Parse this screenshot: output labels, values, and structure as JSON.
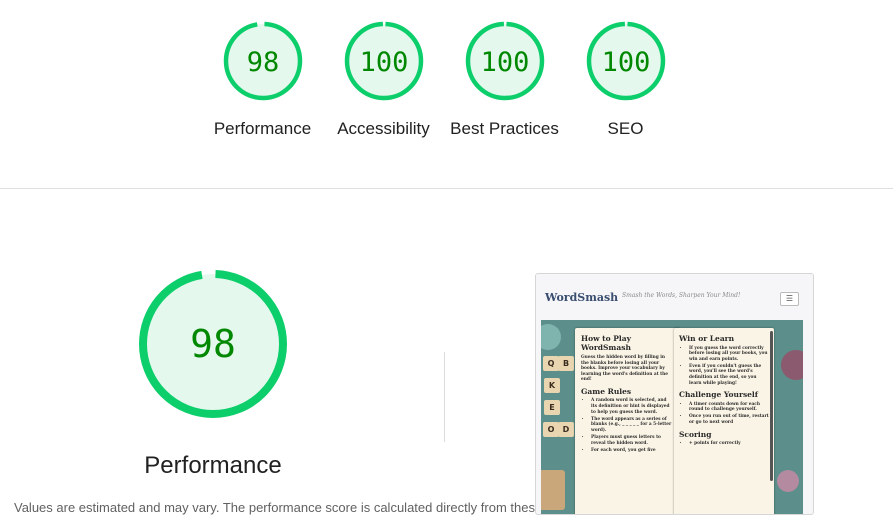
{
  "summary": {
    "categories": [
      {
        "label": "Performance",
        "score": "98",
        "value": 98
      },
      {
        "label": "Accessibility",
        "score": "100",
        "value": 100
      },
      {
        "label": "Best Practices",
        "score": "100",
        "value": 100
      },
      {
        "label": "SEO",
        "score": "100",
        "value": 100
      }
    ]
  },
  "performance": {
    "score": "98",
    "value": 98,
    "label": "Performance",
    "cutoff_text": "Values are estimated and may vary. The performance score is calculated directly from these metrics. See calculator."
  },
  "colors": {
    "pass": "#0cce6b",
    "pass_fill": "#e5f8ee",
    "pass_text": "#008800",
    "divider": "#e0e0e0"
  },
  "screenshot": {
    "logo": "WordSmash",
    "tagline": "Smash the Words, Sharpen Your Mind!",
    "menu_icon": "hamburger-icon",
    "tiles": [
      "Q",
      "B",
      "K",
      "E",
      "O",
      "D"
    ],
    "card_left": {
      "title": "How to Play WordSmash",
      "intro": "Guess the hidden word by filling in the blanks before losing all your books. Improve your vocabulary by learning the word's definition at the end!",
      "rules_title": "Game Rules",
      "rules": [
        "A random word is selected, and its definition or hint is displayed to help you guess the word.",
        "The word appears as a series of blanks (e.g., _ _ _ _ _ for a 5-letter word).",
        "Players must guess letters to reveal the hidden word.",
        "For each word, you get five"
      ]
    },
    "card_right": {
      "title": "Win or Learn",
      "items": [
        "If you guess the word correctly before losing all your books, you win and earn points.",
        "Even if you couldn't guess the word, you'll see the word's definition at the end, so you learn while playing!"
      ],
      "challenge_title": "Challenge Yourself",
      "challenge_items": [
        "A timer counts down for each round to challenge yourself.",
        "Once you run out of time, restart or go to next word"
      ],
      "scoring_title": "Scoring",
      "scoring_items": [
        "+ points for correctly"
      ]
    }
  }
}
